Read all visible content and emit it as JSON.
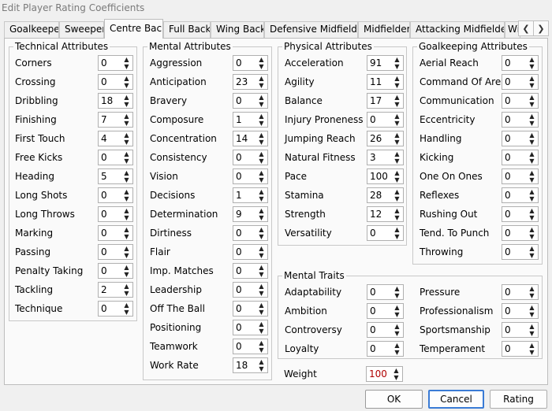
{
  "window": {
    "title": "Edit Player Rating Coefficients"
  },
  "tabs": [
    {
      "label": "Goalkeeper"
    },
    {
      "label": "Sweeper"
    },
    {
      "label": "Centre Back",
      "active": true
    },
    {
      "label": "Full Back"
    },
    {
      "label": "Wing Back"
    },
    {
      "label": "Defensive Midfielder"
    },
    {
      "label": "Midfielder"
    },
    {
      "label": "Attacking Midfielder"
    },
    {
      "label": "Wi"
    }
  ],
  "tab_scroll": {
    "left_icon": "chevron-left-icon",
    "right_icon": "chevron-right-icon"
  },
  "technical": {
    "title": "Technical Attributes",
    "items": [
      {
        "label": "Corners",
        "value": "0"
      },
      {
        "label": "Crossing",
        "value": "0"
      },
      {
        "label": "Dribbling",
        "value": "18"
      },
      {
        "label": "Finishing",
        "value": "7"
      },
      {
        "label": "First Touch",
        "value": "4"
      },
      {
        "label": "Free Kicks",
        "value": "0"
      },
      {
        "label": "Heading",
        "value": "5"
      },
      {
        "label": "Long Shots",
        "value": "0"
      },
      {
        "label": "Long Throws",
        "value": "0"
      },
      {
        "label": "Marking",
        "value": "0"
      },
      {
        "label": "Passing",
        "value": "0"
      },
      {
        "label": "Penalty Taking",
        "value": "0"
      },
      {
        "label": "Tackling",
        "value": "2"
      },
      {
        "label": "Technique",
        "value": "0"
      }
    ]
  },
  "mental": {
    "title": "Mental Attributes",
    "items": [
      {
        "label": "Aggression",
        "value": "0"
      },
      {
        "label": "Anticipation",
        "value": "23"
      },
      {
        "label": "Bravery",
        "value": "0"
      },
      {
        "label": "Composure",
        "value": "1"
      },
      {
        "label": "Concentration",
        "value": "14"
      },
      {
        "label": "Consistency",
        "value": "0"
      },
      {
        "label": "Vision",
        "value": "0"
      },
      {
        "label": "Decisions",
        "value": "1"
      },
      {
        "label": "Determination",
        "value": "9"
      },
      {
        "label": "Dirtiness",
        "value": "0"
      },
      {
        "label": "Flair",
        "value": "0"
      },
      {
        "label": "Imp. Matches",
        "value": "0"
      },
      {
        "label": "Leadership",
        "value": "0"
      },
      {
        "label": "Off The Ball",
        "value": "0"
      },
      {
        "label": "Positioning",
        "value": "0"
      },
      {
        "label": "Teamwork",
        "value": "0"
      },
      {
        "label": "Work Rate",
        "value": "18"
      }
    ]
  },
  "physical": {
    "title": "Physical Attributes",
    "items": [
      {
        "label": "Acceleration",
        "value": "91"
      },
      {
        "label": "Agility",
        "value": "11"
      },
      {
        "label": "Balance",
        "value": "17"
      },
      {
        "label": "Injury Proneness",
        "value": "0"
      },
      {
        "label": "Jumping Reach",
        "value": "26"
      },
      {
        "label": "Natural Fitness",
        "value": "3"
      },
      {
        "label": "Pace",
        "value": "100"
      },
      {
        "label": "Stamina",
        "value": "28"
      },
      {
        "label": "Strength",
        "value": "12"
      },
      {
        "label": "Versatility",
        "value": "0"
      }
    ]
  },
  "goalkeeping": {
    "title": "Goalkeeping Attributes",
    "items": [
      {
        "label": "Aerial Reach",
        "value": "0"
      },
      {
        "label": "Command Of Area",
        "value": "0"
      },
      {
        "label": "Communication",
        "value": "0"
      },
      {
        "label": "Eccentricity",
        "value": "0"
      },
      {
        "label": "Handling",
        "value": "0"
      },
      {
        "label": "Kicking",
        "value": "0"
      },
      {
        "label": "One On Ones",
        "value": "0"
      },
      {
        "label": "Reflexes",
        "value": "0"
      },
      {
        "label": "Rushing Out",
        "value": "0"
      },
      {
        "label": "Tend. To Punch",
        "value": "0"
      },
      {
        "label": "Throwing",
        "value": "0"
      }
    ]
  },
  "traits": {
    "title": "Mental Traits",
    "left": [
      {
        "label": "Adaptability",
        "value": "0"
      },
      {
        "label": "Ambition",
        "value": "0"
      },
      {
        "label": "Controversy",
        "value": "0"
      },
      {
        "label": "Loyalty",
        "value": "0"
      }
    ],
    "right": [
      {
        "label": "Pressure",
        "value": "0"
      },
      {
        "label": "Professionalism",
        "value": "0"
      },
      {
        "label": "Sportsmanship",
        "value": "0"
      },
      {
        "label": "Temperament",
        "value": "0"
      }
    ]
  },
  "weight": {
    "label": "Weight",
    "value": "100",
    "value_color": "#b00000"
  },
  "buttons": {
    "ok": "OK",
    "cancel": "Cancel",
    "rating": "Rating"
  },
  "spin_icons": {
    "up": "▲",
    "down": "▼"
  }
}
